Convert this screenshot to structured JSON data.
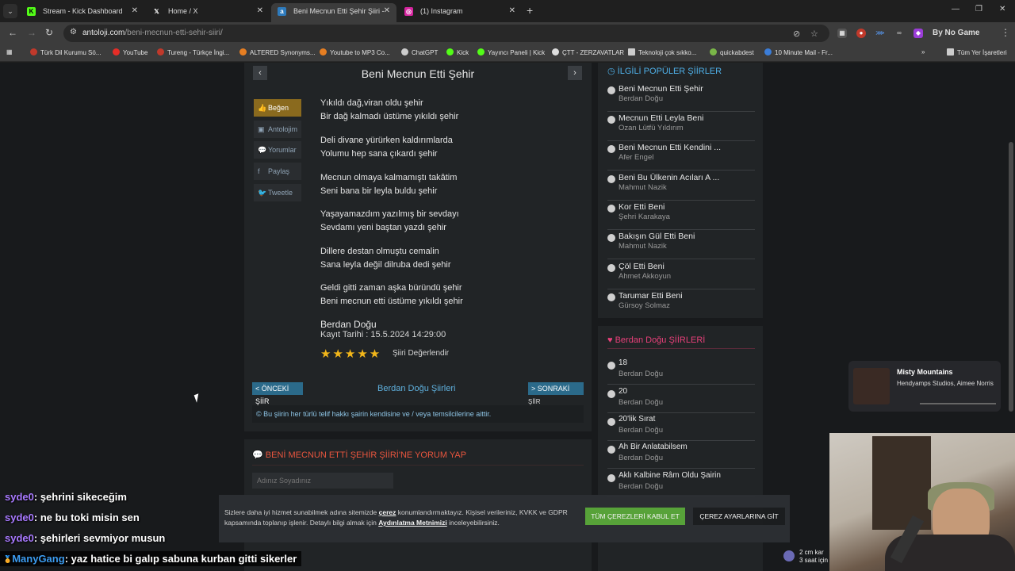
{
  "browser": {
    "tabs": [
      {
        "title": "Stream - Kick Dashboard",
        "favicon": "kick-icon",
        "active": false
      },
      {
        "title": "Home / X",
        "favicon": "x-icon",
        "active": false
      },
      {
        "title": "Beni Mecnun Etti Şehir Şiiri - B...",
        "favicon": "antoloji-icon",
        "active": true
      },
      {
        "title": "(1) Instagram",
        "favicon": "instagram-icon",
        "active": false
      }
    ],
    "url_domain": "antoloji.com",
    "url_path": "/beni-mecnun-etti-sehir-siiri/",
    "profile_label": "By No Game",
    "bookmarks": [
      {
        "label": "Türk Dil Kurumu Sö...",
        "color": "#c0392b"
      },
      {
        "label": "YouTube",
        "color": "#e52d27"
      },
      {
        "label": "Tureng - Türkçe İngi...",
        "color": "#c0392b"
      },
      {
        "label": "ALTERED Synonyms...",
        "color": "#e67e22"
      },
      {
        "label": "Youtube to MP3 Co...",
        "color": "#e67e22"
      },
      {
        "label": "ChatGPT",
        "color": "#cccccc"
      },
      {
        "label": "Kick",
        "color": "#53fc18"
      },
      {
        "label": "Yayıncı Paneli | Kick",
        "color": "#53fc18"
      },
      {
        "label": "ÇTT - ZERZAVATLAR",
        "color": "#dddddd"
      },
      {
        "label": "Teknoloji çok sıkko...",
        "color": "#cccccc"
      },
      {
        "label": "quickabdest",
        "color": "#7ab648"
      },
      {
        "label": "10 Minute Mail - Fr...",
        "color": "#3b7dd8"
      },
      {
        "label": "Tüm Yer İşaretleri",
        "color": "#cccccc"
      }
    ]
  },
  "poem": {
    "title": "Beni Mecnun Etti Şehir",
    "actions": [
      "Beğen",
      "Antolojim",
      "Yorumlar",
      "Paylaş",
      "Tweetle"
    ],
    "stanzas": [
      [
        "Yıkıldı dağ,viran oldu şehir",
        "Bir dağ kalmadı üstüme yıkıldı şehir"
      ],
      [
        "Deli divane yürürken kaldırımlarda",
        "Yolumu hep sana çıkardı şehir"
      ],
      [
        "Mecnun olmaya kalmamıştı takâtim",
        "Seni bana bir leyla buldu şehir"
      ],
      [
        "Yaşayamazdım yazılmış bir sevdayı",
        "Sevdamı yeni baştan yazdı şehir"
      ],
      [
        "Dillere destan olmuştu cemalin",
        "Sana leyla değil dilruba dedi şehir"
      ],
      [
        "Geldi gitti zaman aşka büründü şehir",
        "Beni mecnun etti üstüme yıkıldı şehir"
      ]
    ],
    "author": "Berdan Doğu",
    "date": "Kayıt Tarihi : 15.5.2024 14:29:00",
    "stars": "★★★★★",
    "rate_label": "Şiiri Değerlendir",
    "prev_label": "< ÖNCEKİ ŞİİR",
    "next_label": "> SONRAKİ",
    "next_sub": "ŞİİR",
    "author_poems_link": "Berdan Doğu Şiirleri",
    "copyright": "© Bu şiirin her türlü telif hakkı şairin kendisine ve / veya temsilcilerine aittir."
  },
  "comments": {
    "title": "BENİ MECNUN ETTİ ŞEHİR ŞİİRİ'NE YORUM YAP",
    "name_placeholder": "Adınız Soyadınız"
  },
  "popular": {
    "title": "İLGİLİ POPÜLER ŞİİRLER",
    "items": [
      {
        "title": "Beni Mecnun Etti Şehir",
        "author": "Berdan Doğu"
      },
      {
        "title": "Mecnun Etti Leyla Beni",
        "author": "Ozan Lütfü Yıldırım"
      },
      {
        "title": "Beni Mecnun Etti Kendini ...",
        "author": "Afer Engel"
      },
      {
        "title": "Beni Bu Ülkenin Acıları A ...",
        "author": "Mahmut Nazik"
      },
      {
        "title": "Kor Etti Beni",
        "author": "Şehri Karakaya"
      },
      {
        "title": "Bakışın Gül Etti Beni",
        "author": "Mahmut Nazik"
      },
      {
        "title": "Çöl Etti Beni",
        "author": "Ahmet Akkoyun"
      },
      {
        "title": "Tarumar Etti Beni",
        "author": "Gürsoy Solmaz"
      }
    ]
  },
  "author_poems": {
    "title": "Berdan Doğu ŞİİRLERİ",
    "items": [
      {
        "title": "18",
        "author": "Berdan Doğu"
      },
      {
        "title": "20",
        "author": "Berdan Doğu"
      },
      {
        "title": "20'lik Sırat",
        "author": "Berdan Doğu"
      },
      {
        "title": "Ah Bir Anlatabilsem",
        "author": "Berdan Doğu"
      },
      {
        "title": "Aklı Kalbine Râm Oldu Şairin",
        "author": "Berdan Doğu"
      }
    ]
  },
  "cookie": {
    "text_pre": "Sizlere daha iyi hizmet sunabilmek adına sitemizde ",
    "text_link1": "çerez",
    "text_mid": " konumlandırmaktayız. Kişisel verileriniz, KVKK ve GDPR kapsamında toplanıp işlenir. Detaylı bilgi almak için ",
    "text_link2": "Aydınlatma Metnimizi",
    "text_post": " inceleyebilirsiniz.",
    "accept_label": "TÜM ÇEREZLERİ KABUL ET",
    "settings_label": "ÇEREZ AYARLARINA GİT"
  },
  "stream": {
    "chat": [
      {
        "user": "syde0",
        "message": ": şehrini sikeceğim"
      },
      {
        "user": "syde0",
        "message": ": ne bu toki misin sen"
      },
      {
        "user": "syde0",
        "message": ": şehirleri sevmiyor musun"
      },
      {
        "user": "ManyGang",
        "message": ": yaz hatice bi galıp sabuna kurban gitti sikerler"
      }
    ],
    "music_title": "Misty Mountains",
    "music_artist": "Hendyamps Studios, Aimee Norris",
    "weather_line1": "2 cm kar",
    "weather_line2": "3 saat için"
  }
}
